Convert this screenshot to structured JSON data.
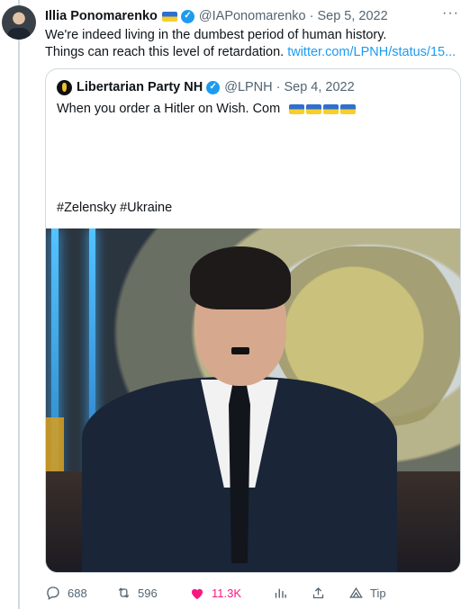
{
  "tweet": {
    "author_name": "Illia Ponomarenko",
    "handle": "@IAPonomarenko",
    "date": "Sep 5, 2022",
    "separator": "·",
    "more_label": "···",
    "text_line1": "We're indeed living in the dumbest period of human history.",
    "text_line2": "Things can reach this level of retardation.",
    "link": "twitter.com/LPNH/status/15..."
  },
  "quoted": {
    "author_name": "Libertarian Party NH",
    "handle": "@LPNH",
    "date": "Sep 4, 2022",
    "separator": "·",
    "text": "When you order a Hitler on Wish. Com",
    "flag_count": 4,
    "hashtags": "#Zelensky #Ukraine"
  },
  "actions": {
    "reply_count": "688",
    "retweet_count": "596",
    "like_count": "11.3K",
    "tip_label": "Tip"
  },
  "icons": {
    "reply": "speech-bubble-icon",
    "retweet": "retweet-arrows-icon",
    "like": "heart-icon",
    "views": "bar-chart-icon",
    "share": "share-upload-icon",
    "tip": "tip-icon"
  },
  "colors": {
    "accent": "#1d9bf0",
    "like": "#f91880",
    "muted": "#536471",
    "flag_blue": "#2f6fd0",
    "flag_yellow": "#f7cf2a"
  }
}
